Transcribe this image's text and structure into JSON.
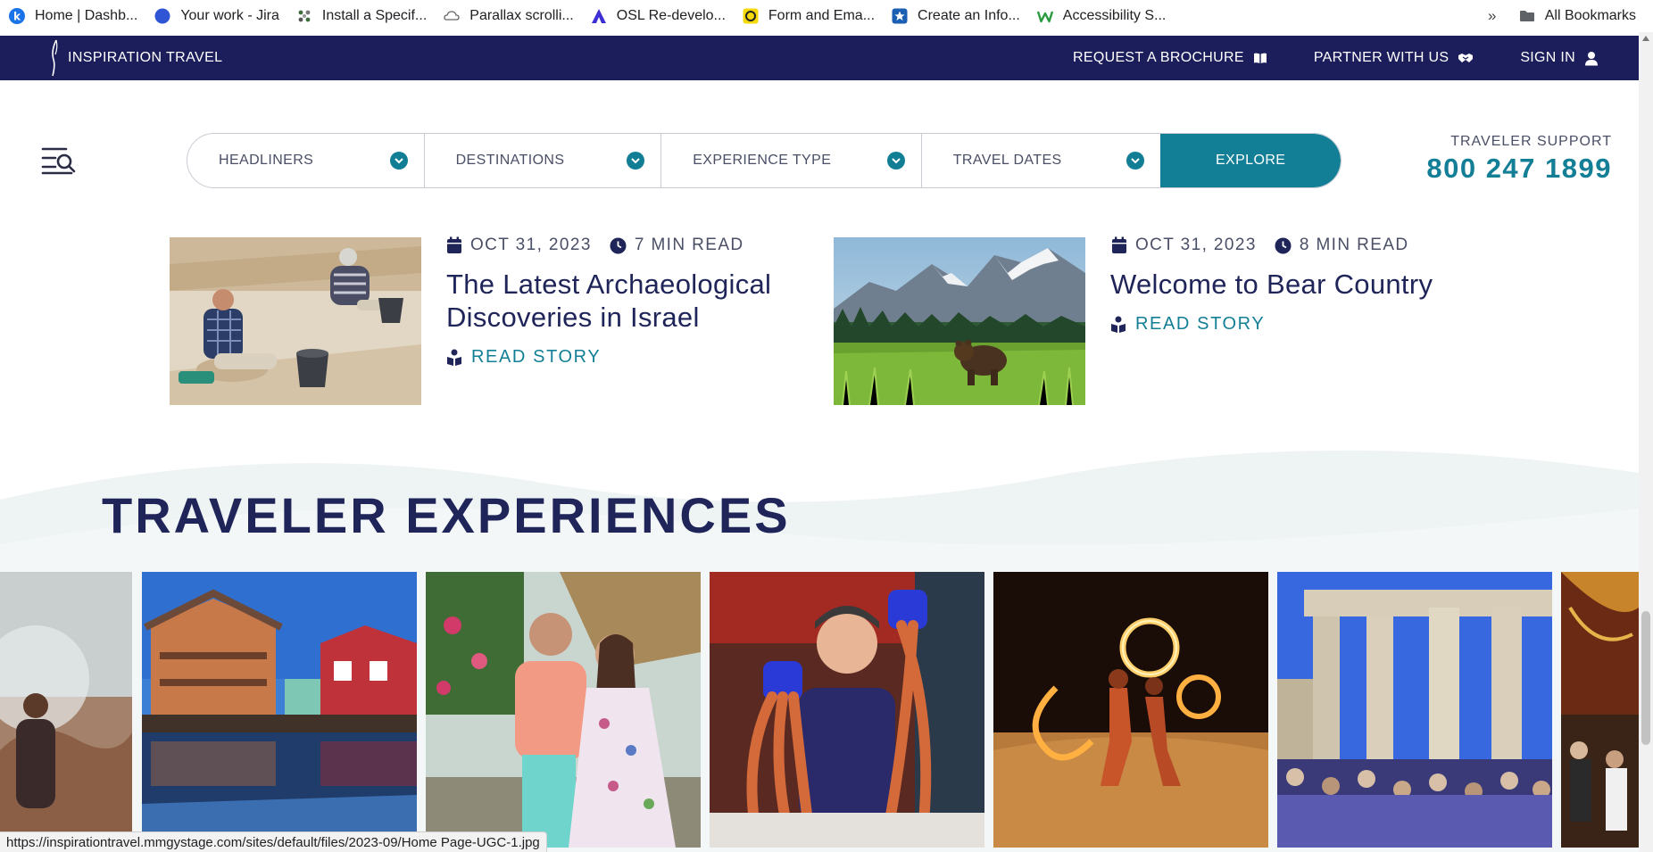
{
  "bookmarks": {
    "items": [
      {
        "label": "Home | Dashb...",
        "icon": "k-circle-icon"
      },
      {
        "label": "Your work - Jira",
        "icon": "blue-circle-icon"
      },
      {
        "label": "Install a Specif...",
        "icon": "dots-icon"
      },
      {
        "label": "Parallax scrolli...",
        "icon": "cloud-icon"
      },
      {
        "label": "OSL Re-develo...",
        "icon": "triangle-logo-icon"
      },
      {
        "label": "Form and Ema...",
        "icon": "yellow-badge-icon"
      },
      {
        "label": "Create an Info...",
        "icon": "blue-star-icon"
      },
      {
        "label": "Accessibility S...",
        "icon": "w-logo-icon"
      }
    ],
    "overflow": "»",
    "all_bookmarks": "All Bookmarks"
  },
  "topnav": {
    "brand": "INSPIRATION TRAVEL",
    "links": [
      {
        "label": "REQUEST A BROCHURE",
        "icon": "book-icon"
      },
      {
        "label": "PARTNER WITH US",
        "icon": "handshake-icon"
      },
      {
        "label": "SIGN IN",
        "icon": "user-icon"
      }
    ]
  },
  "filters": {
    "items": [
      "HEADLINERS",
      "DESTINATIONS",
      "EXPERIENCE TYPE",
      "TRAVEL DATES"
    ],
    "explore": "EXPLORE"
  },
  "support": {
    "label": "TRAVELER SUPPORT",
    "phone": "800 247 1899"
  },
  "stories": [
    {
      "date": "OCT 31, 2023",
      "read_time": "7 MIN READ",
      "title_line1": "The Latest Archaeological",
      "title_line2": "Discoveries in Israel",
      "cta": "READ STORY",
      "image": "archaeology-dig-photo"
    },
    {
      "date": "OCT 31, 2023",
      "read_time": "8 MIN READ",
      "title_line1": "Welcome to Bear Country",
      "title_line2": "",
      "cta": "READ STORY",
      "image": "brown-bear-meadow-photo"
    }
  ],
  "traveler_experiences": {
    "heading": "TRAVELER EXPERIENCES",
    "gallery": [
      "desert-hiker-photo",
      "waterfront-houses-photo",
      "couple-village-photo",
      "king-crab-photo",
      "fire-dancers-photo",
      "parthenon-crowd-photo",
      "ornate-church-photo"
    ]
  },
  "status_url": "https://inspirationtravel.mmgystage.com/sites/default/files/2023-09/Home Page-UGC-1.jpg",
  "colors": {
    "navy": "#1c1e5c",
    "teal": "#137f96",
    "heading": "#1f2459"
  }
}
